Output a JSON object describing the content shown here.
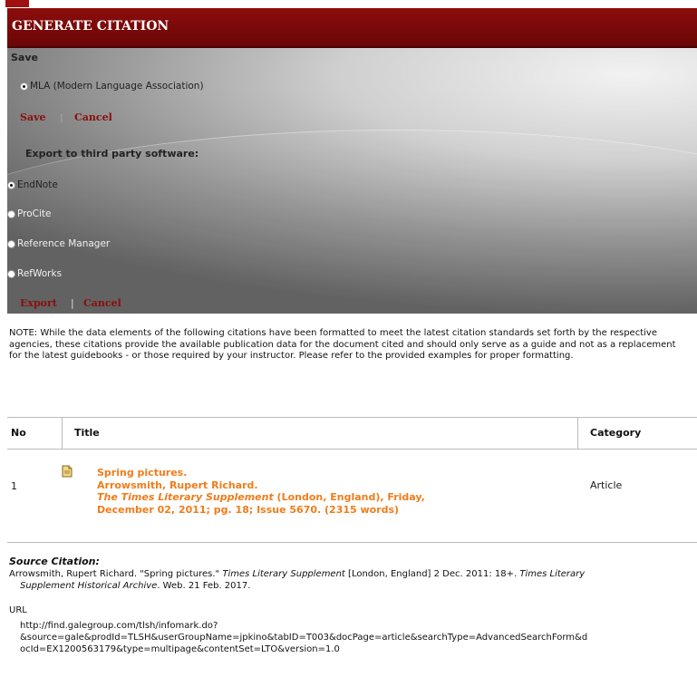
{
  "header": {
    "title": "GENERATE CITATION"
  },
  "save_section": {
    "heading": "Save",
    "format_option": "MLA (Modern Language Association)",
    "save_label": "Save",
    "cancel_label": "Cancel"
  },
  "export_section": {
    "heading": "Export to third party software:",
    "options": [
      "EndNote",
      "ProCite",
      "Reference Manager",
      "RefWorks"
    ],
    "selected": "EndNote",
    "export_label": "Export",
    "cancel_label": "Cancel"
  },
  "note": "NOTE: While the data elements of the following citations have been formatted to meet the latest citation standards set forth by the respective agencies, these citations provide the available publication data for the document cited and should only serve as a guide and not as a replacement for the latest guidebooks - or those required by your instructor. Please refer to the provided examples for proper formatting.",
  "table": {
    "headers": {
      "no": "No",
      "title": "Title",
      "category": "Category"
    },
    "row": {
      "no": "1",
      "title": "Spring pictures.",
      "author": "Arrowsmith, Rupert Richard.",
      "publication": "The Times Literary Supplement",
      "pub_details": " (London, England), Friday,",
      "issue_line": "December 02, 2011; pg. 18; Issue 5670.  (2315 words)",
      "category": "Article"
    }
  },
  "source": {
    "label": "Source Citation:",
    "line1_a": "Arrowsmith, Rupert Richard. \"Spring pictures.\" ",
    "line1_b": "Times Literary Supplement",
    "line1_c": " [London, England] 2 Dec. 2011: 18+. ",
    "line1_d": "Times Literary",
    "line2_a": "Supplement Historical Archive",
    "line2_b": ". Web. 21 Feb. 2017."
  },
  "url": {
    "label": "URL",
    "value": "http://find.galegroup.com/tlsh/infomark.do?&source=gale&prodId=TLSH&userGroupName=jpkino&tabID=T003&docPage=article&searchType=AdvancedSearchForm&docId=EX1200563179&type=multipage&contentSet=LTO&version=1.0",
    "line1": "http://find.galegroup.com/tlsh/infomark.do?",
    "line2": "&source=gale&prodId=TLSH&userGroupName=jpkino&tabID=T003&docPage=article&searchType=AdvancedSearchForm&d",
    "line3": "ocId=EX1200563179&type=multipage&contentSet=LTO&version=1.0"
  },
  "colors": {
    "header": "#8c0d0d",
    "link": "#8b0d0d",
    "citation": "#f07c1a"
  },
  "icons": {
    "document": "document-icon"
  }
}
